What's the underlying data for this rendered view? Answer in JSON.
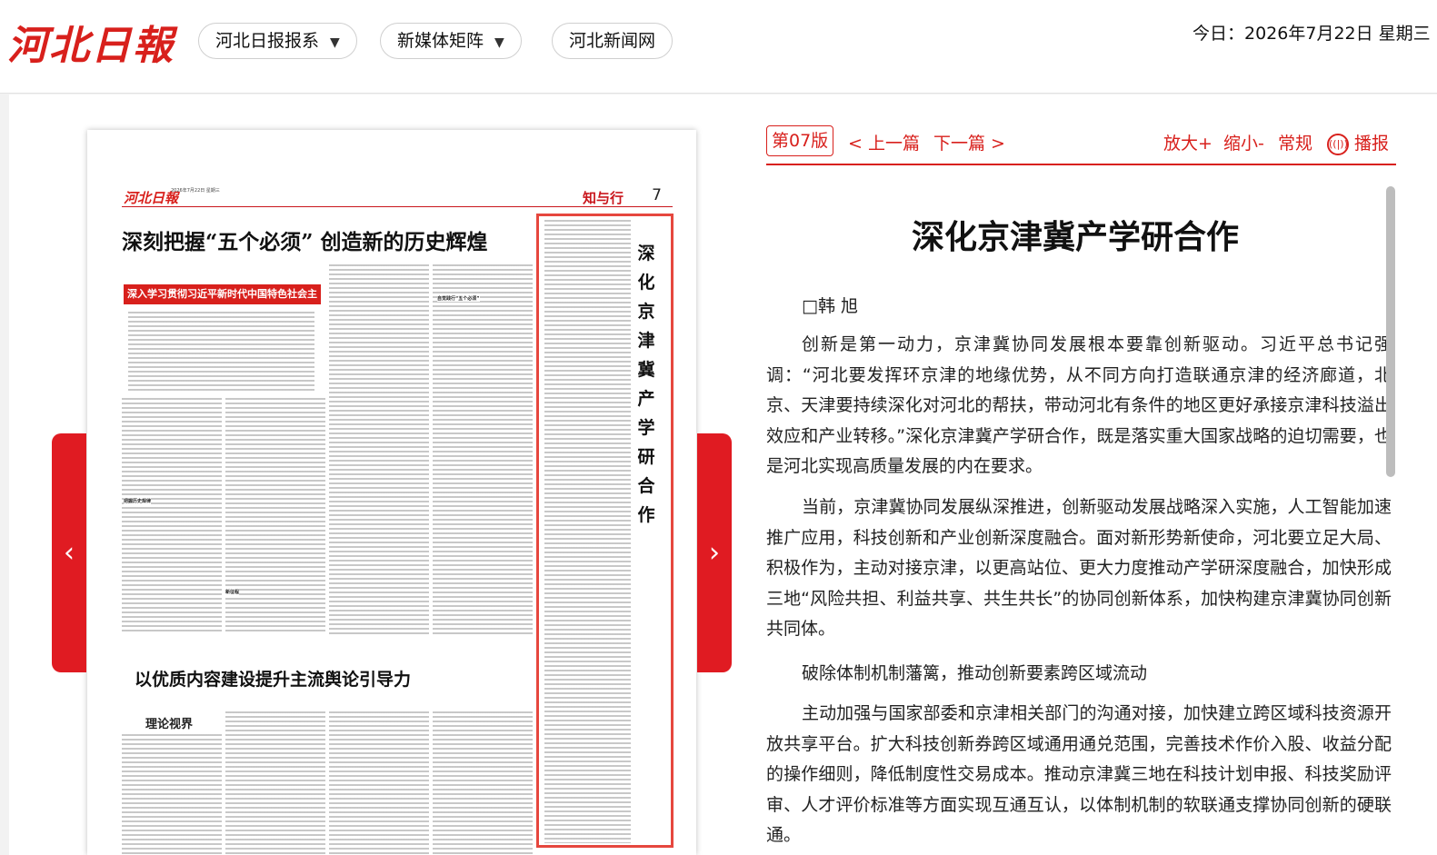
{
  "header": {
    "logo_text": "河北日報",
    "nav": [
      {
        "label": "河北日报报系",
        "caret": "▼"
      },
      {
        "label": "新媒体矩阵",
        "caret": "▼"
      },
      {
        "label": "河北新闻网"
      }
    ],
    "date_text": "今日：2026年7月22日 星期三"
  },
  "newspaper": {
    "masthead": "河北日報",
    "meta_line": "2026年7月22日 星期三",
    "section_name": "知与行",
    "page_number": "7",
    "headline_top": "深刻把握“五个必须” 创造新的历史辉煌",
    "banner": "深入学习贯彻习近平新时代中国特色社会主义思想",
    "headline_bottom": "以优质内容建设提升主流舆论引导力",
    "column_label": "理论视界",
    "highlighted_title": "深化京津冀产学研合作",
    "prev_arrow": "‹",
    "next_arrow": "›"
  },
  "reader": {
    "page_badge": "第07版",
    "prev_label": "< 上一篇",
    "next_label": "下一篇 >",
    "zoom_in": "放大+",
    "zoom_out": "缩小-",
    "normal": "常规",
    "listen": "播报",
    "listen_icon": "((|))",
    "title": "深化京津冀产学研合作",
    "author": "□韩 旭",
    "paragraphs": [
      "创新是第一动力，京津冀协同发展根本要靠创新驱动。习近平总书记强调：“河北要发挥环京津的地缘优势，从不同方向打造联通京津的经济廊道，北京、天津要持续深化对河北的帮扶，带动河北有条件的地区更好承接京津科技溢出效应和产业转移。”深化京津冀产学研合作，既是落实重大国家战略的迫切需要，也是河北实现高质量发展的内在要求。",
      "当前，京津冀协同发展纵深推进，创新驱动发展战略深入实施，人工智能加速推广应用，科技创新和产业创新深度融合。面对新形势新使命，河北要立足大局、积极作为，主动对接京津，以更高站位、更大力度推动产学研深度融合，加快形成三地“风险共担、利益共享、共生共长”的协同创新体系，加快构建京津冀协同创新共同体。"
    ],
    "subheading": "破除体制机制藩篱，推动创新要素跨区域流动",
    "paragraph3": "主动加强与国家部委和京津相关部门的沟通对接，加快建立跨区域科技资源开放共享平台。扩大科技创新券跨区域通用通兑范围，完善技术作价入股、收益分配的操作细则，降低制度性交易成本。推动京津冀三地在科技计划申报、科技奖励评审、人才评价标准等方面实现互通互认，以体制机制的软联通支撑协同创新的硬联通。"
  }
}
